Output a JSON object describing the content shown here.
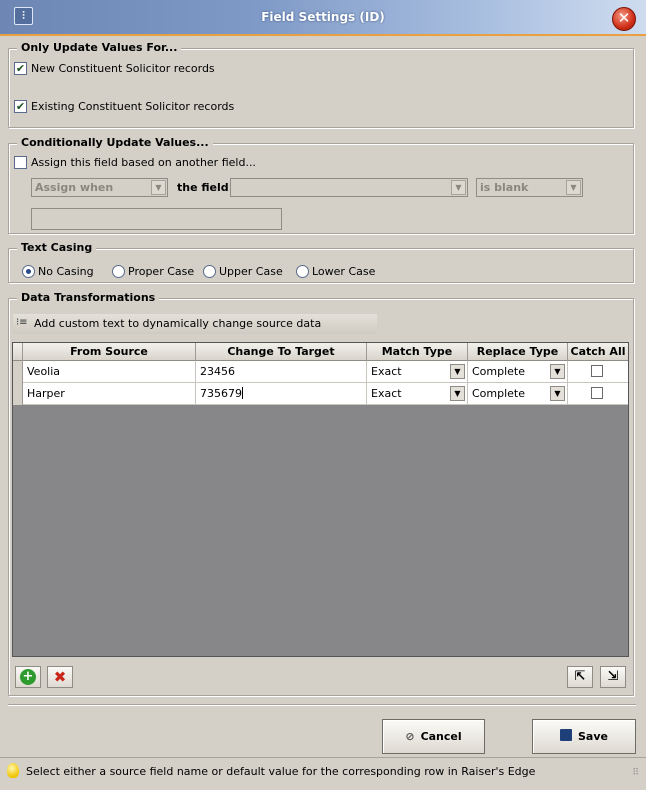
{
  "window": {
    "title": "Field Settings (ID)",
    "title_icon": "settings-sliders-icon",
    "close_icon": "close-icon"
  },
  "only_update": {
    "legend": "Only Update Values For...",
    "new_label": "New Constituent Solicitor records",
    "new_checked": true,
    "existing_label": "Existing Constituent Solicitor records",
    "existing_checked": true
  },
  "conditional": {
    "legend": "Conditionally Update Values...",
    "assign_label": "Assign this field based on another field...",
    "assign_checked": false,
    "assign_when": "Assign when",
    "the_field_label": "the field",
    "field_value": "",
    "condition": "is blank",
    "value_input": ""
  },
  "text_casing": {
    "legend": "Text Casing",
    "options": [
      "No Casing",
      "Proper Case",
      "Upper Case",
      "Lower Case"
    ],
    "selected": "No Casing"
  },
  "transformations": {
    "legend": "Data Transformations",
    "add_custom_text": "Add custom text to dynamically change source data",
    "columns": [
      "From Source",
      "Change To Target",
      "Match Type",
      "Replace Type",
      "Catch All"
    ],
    "rows": [
      {
        "from": "Veolia",
        "to": "23456",
        "match": "Exact",
        "replace": "Complete",
        "catch_all": false
      },
      {
        "from": "Harper",
        "to": "735679",
        "match": "Exact",
        "replace": "Complete",
        "catch_all": false
      }
    ]
  },
  "toolbar": {
    "add_icon": "add-row-icon",
    "delete_icon": "delete-row-icon",
    "export_icon": "export-icon",
    "import_icon": "import-icon"
  },
  "buttons": {
    "cancel": "Cancel",
    "save": "Save"
  },
  "status": {
    "text": "Select either a source field name or default value for the corresponding row in Raiser's Edge"
  },
  "colors": {
    "title_gradient_start": "#6d86b3",
    "title_accent": "#e8a040",
    "grid_background": "#878689",
    "window_background": "#d4d0c8"
  }
}
